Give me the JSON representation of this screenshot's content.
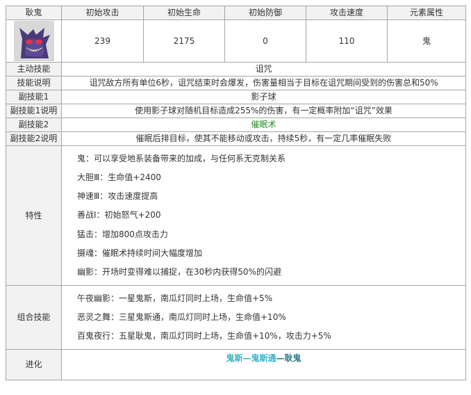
{
  "header": {
    "name": "耿鬼",
    "cols": [
      "初始攻击",
      "初始生命",
      "初始防御",
      "攻击速度",
      "元素属性"
    ]
  },
  "stats": [
    "239",
    "2175",
    "0",
    "110",
    "鬼"
  ],
  "rows": [
    {
      "label": "主动技能",
      "value": "诅咒"
    },
    {
      "label": "技能说明",
      "value": "诅咒敌方所有单位6秒，诅咒结束时会爆发，伤害量相当于目标在诅咒期间受到的伤害总和50%"
    },
    {
      "label": "副技能1",
      "value": "影子球"
    },
    {
      "label": "副技能1说明",
      "value": "使用影子球对随机目标造成255%的伤害，有一定概率附加“诅咒”效果"
    },
    {
      "label": "副技能2",
      "value": "催眠术"
    },
    {
      "label": "副技能2说明",
      "value": "催眠后排目标，使其不能移动或攻击，持续5秒，有一定几率催眠失败"
    }
  ],
  "traits": {
    "label": "特性",
    "items": [
      "鬼：可以享受地系装备带来的加成，与任何系无克制关系",
      "大胆Ⅲ：生命值+2400",
      "神速Ⅲ：攻击速度提高",
      "善战Ⅰ：初始怒气+200",
      "猛击：增加800点攻击力",
      "摄魂：催眠术持续时间大幅度增加",
      "幽影：开场时变得难以捕捉，在30秒内获得50%的闪避"
    ]
  },
  "combos": {
    "label": "组合技能",
    "items": [
      "午夜幽影：一星鬼斯，南瓜灯同时上场，生命值+5%",
      "恶灵之舞：三星鬼斯通，南瓜灯同时上场，生命值+10%",
      "百鬼夜行：五星耿鬼，南瓜灯同时上场，生命值+10%，攻击力+5%"
    ]
  },
  "evolution": {
    "label": "进化",
    "stage1": "鬼斯",
    "sep1": "—",
    "stage2": "鬼斯通",
    "sep2": "—",
    "stage3": "耿鬼"
  },
  "colors": {
    "border": "#a6a6a6",
    "label_bg": "#f2f2f2",
    "green_text": "#2a8a2a",
    "evo_cyan": "#33b5c7",
    "evo_dark": "#2a7a85"
  },
  "icons": {
    "avatar": "gengar-portrait"
  }
}
